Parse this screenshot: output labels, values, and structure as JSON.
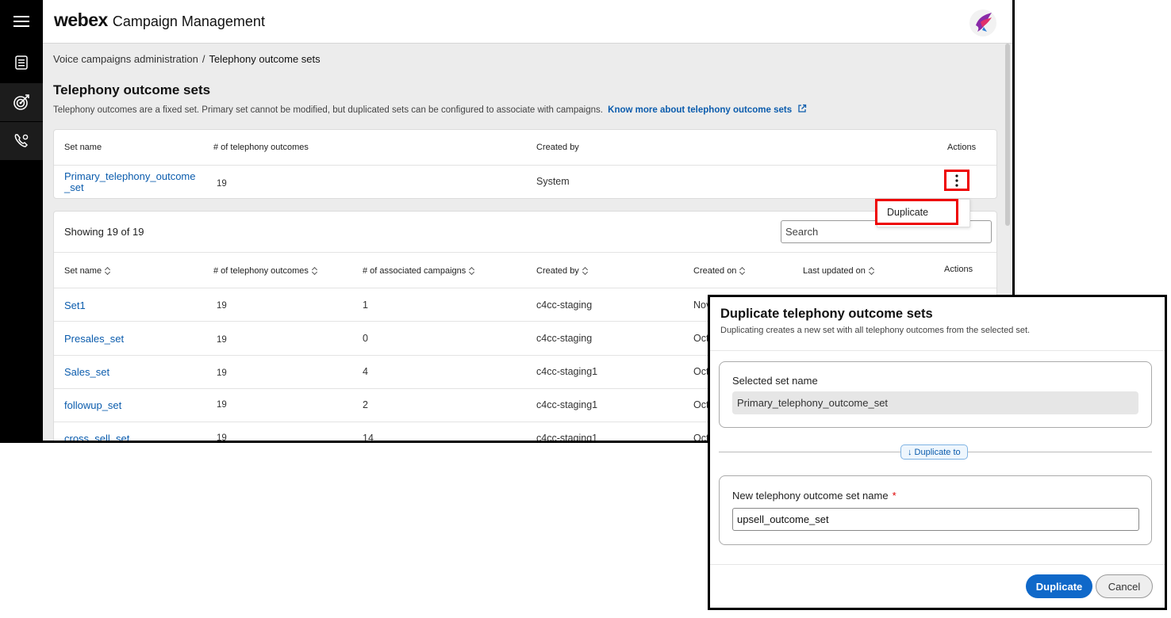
{
  "header": {
    "logo": "webex",
    "product": "Campaign Management"
  },
  "rail": {
    "icons": [
      "menu-icon",
      "list-icon",
      "target-icon",
      "phone-settings-icon"
    ]
  },
  "breadcrumb": {
    "parent": "Voice campaigns administration",
    "separator": "/",
    "current": "Telephony outcome sets"
  },
  "page": {
    "title": "Telephony outcome sets",
    "description": "Telephony outcomes are a fixed set. Primary set cannot be modified, but duplicated sets can be configured to associate with campaigns.",
    "link": "Know more about telephony outcome sets"
  },
  "primary_table": {
    "headers": {
      "set_name": "Set name",
      "outcomes": "# of telephony outcomes",
      "created_by": "Created by",
      "actions": "Actions"
    },
    "row": {
      "name_line1": "Primary_telephony_outcome",
      "name_line2": "_set",
      "outcomes": "19",
      "created_by": "System"
    }
  },
  "menu": {
    "duplicate": "Duplicate"
  },
  "sets_table": {
    "showing": "Showing 19 of 19",
    "search_placeholder": "Search",
    "headers": {
      "set_name": "Set name",
      "outcomes": "# of telephony outcomes",
      "campaigns": "# of associated campaigns",
      "created_by": "Created by",
      "created_on": "Created on",
      "last_updated": "Last updated on",
      "actions": "Actions"
    },
    "rows": [
      {
        "name": "Set1",
        "outcomes": "19",
        "campaigns": "1",
        "created_by": "c4cc-staging",
        "created_on": "Nov"
      },
      {
        "name": "Presales_set",
        "outcomes": "19",
        "campaigns": "0",
        "created_by": "c4cc-staging",
        "created_on": "Oct"
      },
      {
        "name": "Sales_set",
        "outcomes": "19",
        "campaigns": "4",
        "created_by": "c4cc-staging1",
        "created_on": "Oct"
      },
      {
        "name": "followup_set",
        "outcomes": "19",
        "campaigns": "2",
        "created_by": "c4cc-staging1",
        "created_on": "Oct"
      },
      {
        "name": "cross_sell_set",
        "outcomes": "19",
        "campaigns": "14",
        "created_by": "c4cc-staging1",
        "created_on": "Oct"
      }
    ]
  },
  "modal": {
    "title": "Duplicate telephony outcome sets",
    "subtitle": "Duplicating creates a new set with all telephony outcomes from the selected set.",
    "selected_label": "Selected set name",
    "selected_value": "Primary_telephony_outcome_set",
    "duplicate_to": "↓ Duplicate to",
    "new_label": "New telephony outcome set name",
    "required_mark": "*",
    "new_value": "upsell_outcome_set",
    "primary_button": "Duplicate",
    "cancel_button": "Cancel"
  },
  "colors": {
    "link": "#0b5cad",
    "primary_button": "#0f68c9",
    "highlight": "#e00000",
    "rail": "#000000"
  }
}
